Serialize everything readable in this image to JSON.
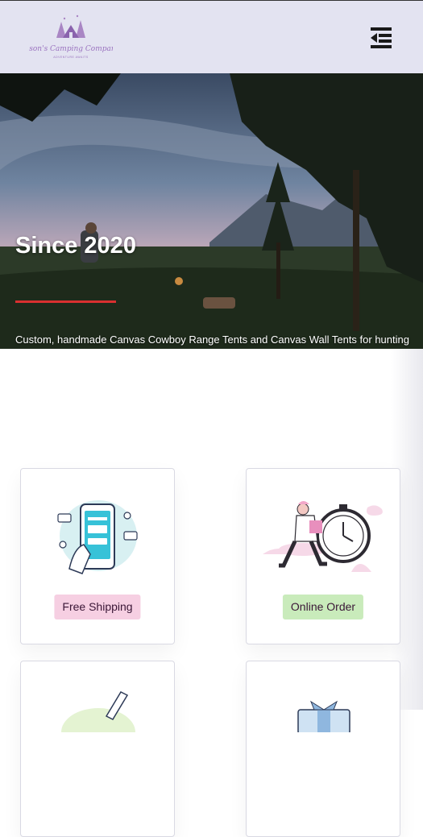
{
  "header": {
    "logo_text": "Jason's Camping Company",
    "logo_tagline": "ADVENTURE AWAITS",
    "menu_icon": "menu-collapse-icon"
  },
  "hero": {
    "title": "Since 2020",
    "description": "Custom, handmade Canvas Cowboy Range Tents and Canvas Wall Tents for hunting camping, gamping and backyard fun. Made in Sheridan, Wyoming.",
    "accent_color": "#d93030"
  },
  "features": [
    {
      "label": "Free Shipping",
      "badge_color": "#f6cfe2",
      "icon": "mobile-payment-icon"
    },
    {
      "label": "Online Order",
      "badge_color": "#c9ebbb",
      "icon": "delivery-stopwatch-icon"
    }
  ]
}
